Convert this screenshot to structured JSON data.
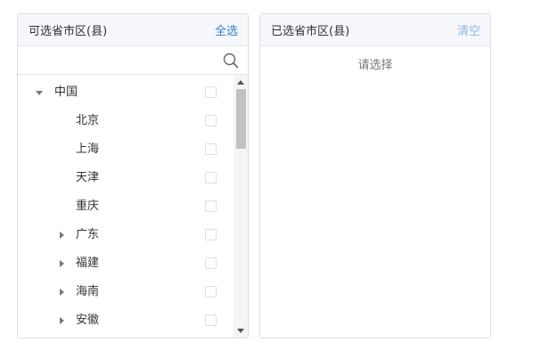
{
  "left_panel": {
    "title": "可选省市区(县)",
    "select_all": "全选",
    "search": {
      "value": "",
      "placeholder": ""
    }
  },
  "tree": [
    {
      "label": "中国",
      "level": 0,
      "arrow": "down"
    },
    {
      "label": "北京",
      "level": 1,
      "arrow": "none"
    },
    {
      "label": "上海",
      "level": 1,
      "arrow": "none"
    },
    {
      "label": "天津",
      "level": 1,
      "arrow": "none"
    },
    {
      "label": "重庆",
      "level": 1,
      "arrow": "none"
    },
    {
      "label": "广东",
      "level": 1,
      "arrow": "right"
    },
    {
      "label": "福建",
      "level": 1,
      "arrow": "right"
    },
    {
      "label": "海南",
      "level": 1,
      "arrow": "right"
    },
    {
      "label": "安徽",
      "level": 1,
      "arrow": "right"
    }
  ],
  "right_panel": {
    "title": "已选省市区(县)",
    "clear": "清空",
    "empty_text": "请选择"
  },
  "colors": {
    "accent": "#2f7fc8",
    "accent_muted": "#8fb8e0",
    "border": "#dcdfe6",
    "header_bg": "#f5f7fa"
  },
  "icons": {
    "search": "search-icon",
    "expanded": "caret-down-icon",
    "collapsed": "caret-right-icon"
  }
}
